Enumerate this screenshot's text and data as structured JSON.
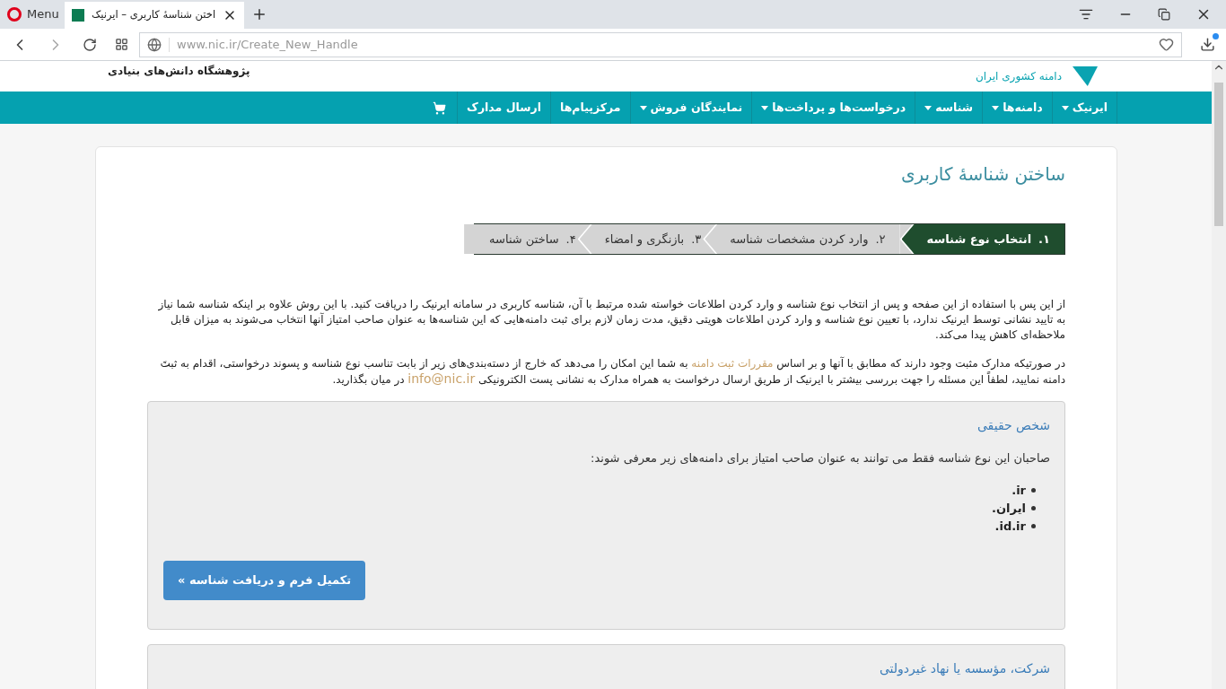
{
  "browser": {
    "menu_label": "Menu",
    "tab_title": "اختن شناسهٔ کاربری – ایرنیک",
    "url_host": "www.nic.ir",
    "url_path": "/Create_New_Handle"
  },
  "header": {
    "institute": "پژوهشگاه دانش‌های بنیادی",
    "logo_text": "دامنه کشوری ایران"
  },
  "nav": [
    {
      "label": "ایرنیک",
      "dropdown": true
    },
    {
      "label": "دامنه‌ها",
      "dropdown": true
    },
    {
      "label": "شناسه",
      "dropdown": true
    },
    {
      "label": "درخواست‌ها و پرداخت‌ها",
      "dropdown": true
    },
    {
      "label": "نمایندگان فروش",
      "dropdown": true
    },
    {
      "label": "مرکزپیام‌ها",
      "dropdown": false
    },
    {
      "label": "ارسال مدارک",
      "dropdown": false
    }
  ],
  "page_title": "ساختن شناسهٔ کاربری",
  "steps": [
    {
      "number": "۱.",
      "label": "انتخاب نوع شناسه",
      "selected": true
    },
    {
      "number": "۲.",
      "label": "وارد کردن مشخصات شناسه",
      "selected": false
    },
    {
      "number": "۳.",
      "label": "بازنگری و امضاء",
      "selected": false
    },
    {
      "number": "۴.",
      "label": "ساختن شناسه",
      "selected": false
    }
  ],
  "intro": "از این پس با استفاده از این صفحه و پس از انتخاب نوع شناسه و وارد کردن اطلاعات خواسته شده مرتبط با آن، شناسه کاربری در سامانه ایرنیک را دریافت کنید. با این روش علاوه بر اینکه شناسه شما نیاز به تایید نشانی توسط ایرنیک ندارد، با تعیین نوع شناسه و وارد کردن اطلاعات هویتی دقیق، مدت زمان لازم برای ثبت دامنه‌هایی که این شناسه‌ها به عنوان صاحب امتیاز آنها انتخاب می‌شوند به میزان قابل ملاحظه‌ای کاهش پیدا می‌کند.",
  "note": {
    "before": "در صورتیکه مدارک مثبت وجود دارند که مطابق با آنها و بر اساس ",
    "rules_link": "مقررات ثبت دامنه",
    "middle": " به شما این امکان را می‌دهد که خارج از دسته‌بندی‌های زیر از بابت تناسب نوع شناسه و پسوند درخواستی، اقدام به ثبتَ دامنه نمایید، لطفاً این مسئله را جهت بررسی بیشتر با ایرنیک از طریق ارسال درخواست به همراه مدارک به نشانی پست الکترونیکی ",
    "email_link": "info@nic.ir",
    "after": " در میان بگذارید."
  },
  "types": [
    {
      "title": "شخص حقیقی",
      "description": "صاحبان این نوع شناسه فقط می توانند به عنوان صاحب امتیاز برای دامنه‌های زیر معرفی شوند:",
      "domains": [
        ".ir",
        ".ایران",
        ".id.ir"
      ],
      "button": "تکمیل فرم و دریافت شناسه »"
    },
    {
      "title": "شرکت، مؤسسه یا نهاد غیردولتی"
    }
  ]
}
